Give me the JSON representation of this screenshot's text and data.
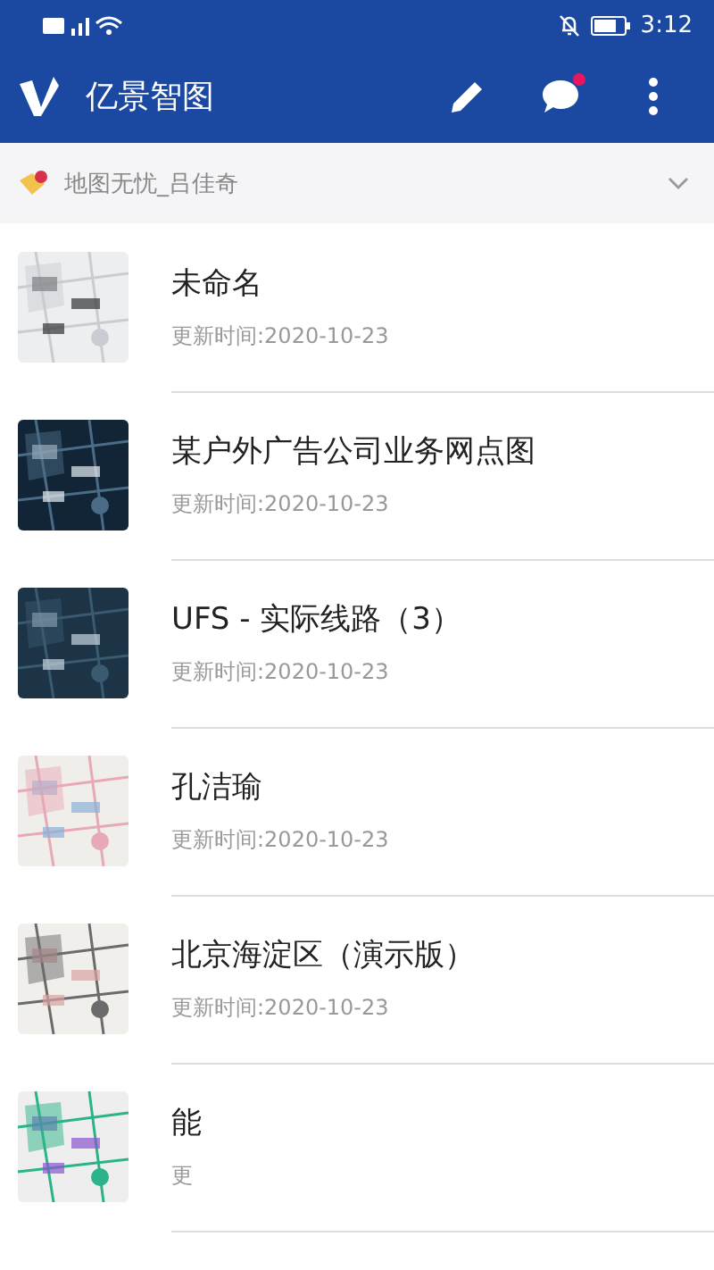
{
  "status_bar": {
    "time": "3:12"
  },
  "app_bar": {
    "title": "亿景智图",
    "has_unread": true
  },
  "account": {
    "name": "地图无忧_吕佳奇"
  },
  "maps": [
    {
      "title": "未命名",
      "updated": "更新时间:2020-10-23"
    },
    {
      "title": "某户外广告公司业务网点图",
      "updated": "更新时间:2020-10-23"
    },
    {
      "title": "UFS - 实际线路（3）",
      "updated": "更新时间:2020-10-23"
    },
    {
      "title": "孔洁瑜",
      "updated": "更新时间:2020-10-23"
    },
    {
      "title": "北京海淀区（演示版）",
      "updated": "更新时间:2020-10-23"
    },
    {
      "title": "能",
      "updated": "更"
    }
  ]
}
